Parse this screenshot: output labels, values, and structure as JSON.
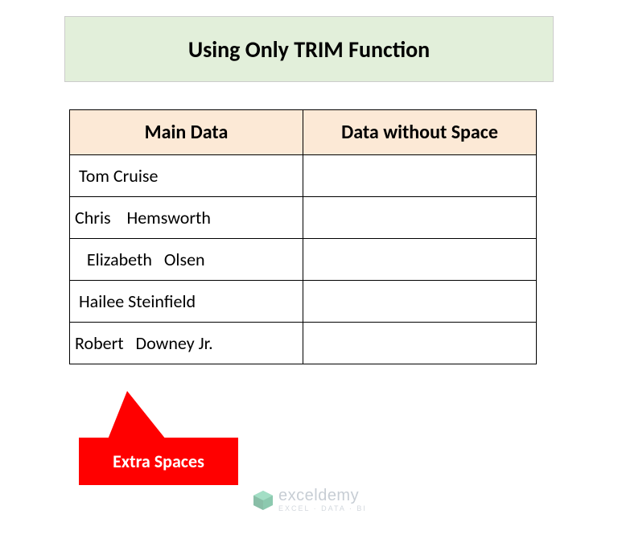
{
  "title": "Using Only TRIM Function",
  "headers": {
    "main": "Main Data",
    "result": "Data without Space"
  },
  "rows": [
    {
      "main": " Tom Cruise",
      "result": ""
    },
    {
      "main": "Chris    Hemsworth",
      "result": ""
    },
    {
      "main": "   Elizabeth   Olsen",
      "result": ""
    },
    {
      "main": " Hailee Steinfield",
      "result": ""
    },
    {
      "main": "Robert   Downey Jr.",
      "result": ""
    }
  ],
  "callout": {
    "label": "Extra Spaces"
  },
  "watermark": {
    "brand": "exceldemy",
    "tagline": "EXCEL · DATA · BI"
  }
}
